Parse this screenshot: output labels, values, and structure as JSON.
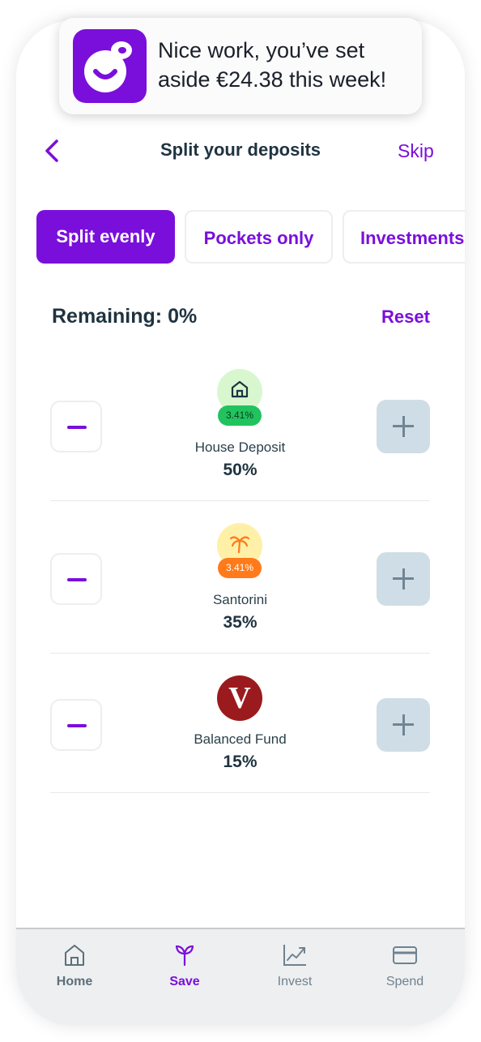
{
  "toast": {
    "line1": "Nice work, you’ve set",
    "line2": "aside €24.38 this week!"
  },
  "header": {
    "back_icon": "chevron-left-icon",
    "title": "Split your deposits",
    "skip_label": "Skip"
  },
  "tabs": [
    {
      "label": "Split evenly",
      "active": true
    },
    {
      "label": "Pockets only",
      "active": false
    },
    {
      "label": "Investments",
      "active": false
    }
  ],
  "summary": {
    "remaining_label": "Remaining: 0%",
    "reset_label": "Reset"
  },
  "allocations": [
    {
      "name": "House Deposit",
      "percent": "50%",
      "rate": "3.41%",
      "icon": "house-icon",
      "icon_bg": "#d9f7cf",
      "badge_bg": "#21c35e"
    },
    {
      "name": "Santorini",
      "percent": "35%",
      "rate": "3.41%",
      "icon": "palm-tree-icon",
      "icon_bg": "#fff0a8",
      "badge_bg": "#ff7a1a"
    },
    {
      "name": "Balanced Fund",
      "percent": "15%",
      "icon": "vanguard-logo-icon",
      "logo_letter": "V",
      "icon_bg": "#9b1a1e"
    }
  ],
  "nav": [
    {
      "label": "Home",
      "icon": "home-icon",
      "active": false
    },
    {
      "label": "Save",
      "icon": "sprout-icon",
      "active": true
    },
    {
      "label": "Invest",
      "icon": "chart-icon",
      "active": false
    },
    {
      "label": "Spend",
      "icon": "card-icon",
      "active": false
    }
  ],
  "colors": {
    "accent": "#7a0fdb",
    "text_dark": "#1f3340",
    "plus_bg": "#cfdde6"
  }
}
